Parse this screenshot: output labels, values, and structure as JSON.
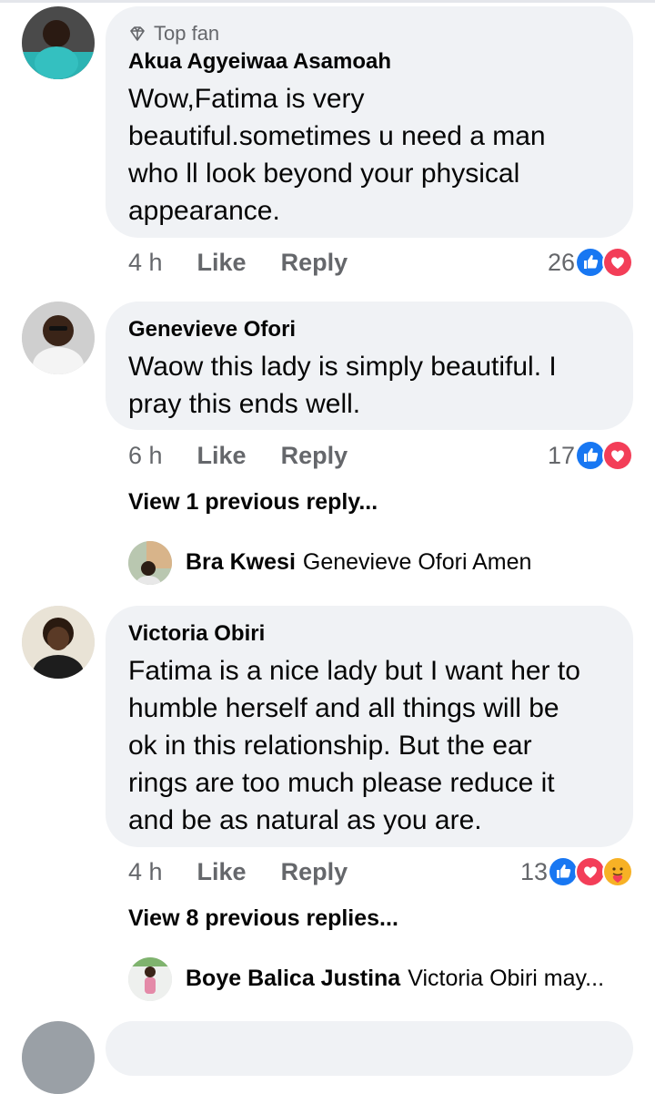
{
  "colors": {
    "bubble": "#f0f2f5",
    "muted": "#65676b",
    "like_blue": "#1877f2",
    "love_red": "#f33e58",
    "care_yellow": "#f7b125"
  },
  "comments": [
    {
      "badge_icon": "diamond-icon",
      "badge": "Top fan",
      "author": "Akua Agyeiwaa Asamoah",
      "text_lines": [
        "Wow,Fatima is very",
        "beautiful.sometimes u need a man",
        "who ll look beyond your physical",
        "appearance."
      ],
      "time": "4 h",
      "like": "Like",
      "reply": "Reply",
      "reaction_count": "26",
      "reactions": [
        "like-icon",
        "love-icon"
      ]
    },
    {
      "author": "Genevieve Ofori",
      "text_lines": [
        "Waow this lady is simply beautiful. I",
        "pray this ends well."
      ],
      "time": "6 h",
      "like": "Like",
      "reply": "Reply",
      "reaction_count": "17",
      "reactions": [
        "like-icon",
        "love-icon"
      ],
      "view_more": "View 1 previous reply...",
      "reply_preview": {
        "author": "Bra Kwesi",
        "text": "Genevieve Ofori Amen"
      }
    },
    {
      "author": "Victoria Obiri",
      "text_lines": [
        "Fatima is a nice lady but I want her to",
        "humble herself and all things will be",
        "ok in this relationship. But the ear",
        "rings are too much please reduce it",
        "and be as natural as you are."
      ],
      "time": "4 h",
      "like": "Like",
      "reply": "Reply",
      "reaction_count": "13",
      "reactions": [
        "like-icon",
        "love-icon",
        "care-icon"
      ],
      "view_more": "View 8 previous replies...",
      "reply_preview": {
        "author": "Boye Balica Justina",
        "text": "Victoria Obiri may..."
      }
    }
  ]
}
